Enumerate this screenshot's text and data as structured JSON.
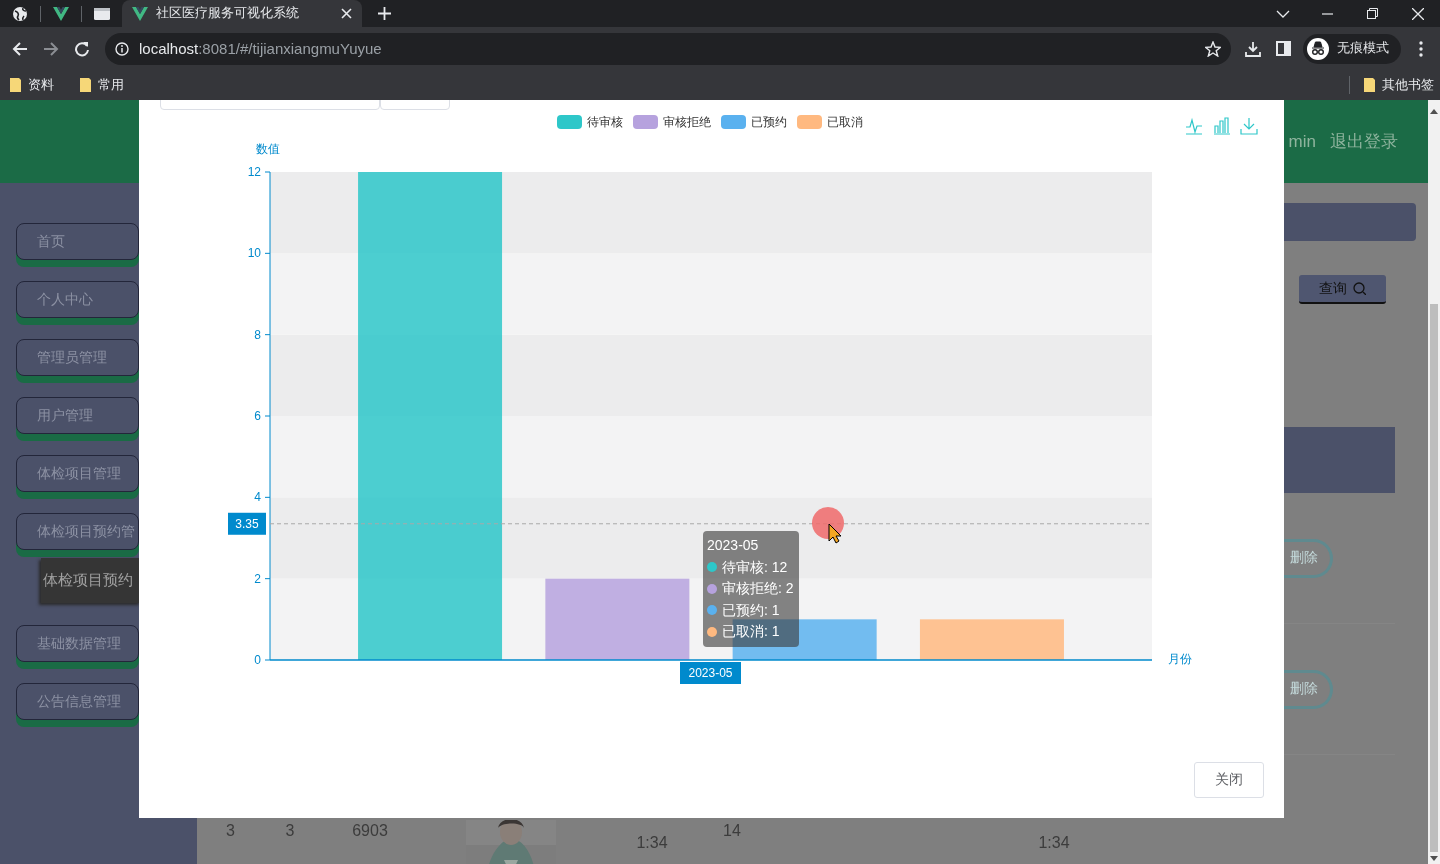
{
  "browser": {
    "tabs": [
      {
        "kind": "globe",
        "selected": false
      },
      {
        "kind": "vue",
        "selected": false
      },
      {
        "kind": "window",
        "selected": false
      },
      {
        "kind": "vue",
        "title": "社区医疗服务可视化系统",
        "selected": true
      }
    ],
    "url": {
      "host": "localhost",
      "path": ":8081/#/tijianxiangmuYuyue"
    },
    "profile": "无痕模式",
    "bookmarks": [
      "资料",
      "常用"
    ],
    "other_bookmarks": "其他书签"
  },
  "header": {
    "user": "min",
    "logout": "退出登录"
  },
  "sidebar": {
    "items": [
      {
        "label": "首页"
      },
      {
        "label": "个人中心"
      },
      {
        "label": "管理员管理"
      },
      {
        "label": "用户管理"
      },
      {
        "label": "体检项目管理"
      },
      {
        "label": "体检项目预约管",
        "children": [
          {
            "label": "体检项目预约"
          }
        ]
      },
      {
        "label": "基础数据管理"
      },
      {
        "label": "公告信息管理"
      }
    ]
  },
  "content": {
    "search_button": "查询",
    "table": {
      "rows": [
        {
          "delete_button": "删除"
        },
        {
          "delete_button": "删除"
        },
        {
          "cells": [
            {
              "kind": "text",
              "text": "3"
            },
            {
              "kind": "text",
              "text": "3"
            },
            {
              "kind": "text",
              "text": "6903"
            },
            {
              "kind": "picture"
            },
            {
              "kind": "wrapped",
              "text": "1:34"
            },
            {
              "kind": "text",
              "text": "14"
            },
            {
              "kind": "wrapped",
              "text": "1:34"
            }
          ]
        }
      ]
    }
  },
  "modal": {
    "chart_data": {
      "type": "bar",
      "xlabel": "月份",
      "ylabel": "数值",
      "series": [
        {
          "name": "待审核",
          "color": "#2ec7c9",
          "values": [
            12
          ]
        },
        {
          "name": "审核拒绝",
          "color": "#b6a2de",
          "values": [
            2
          ]
        },
        {
          "name": "已预约",
          "color": "#5ab1ef",
          "values": [
            1
          ]
        },
        {
          "name": "已取消",
          "color": "#ffb980",
          "values": [
            1
          ]
        }
      ],
      "ylim": [
        0,
        12
      ],
      "yticks": [
        0,
        2,
        4,
        6,
        8,
        10,
        12
      ],
      "legend": "top"
    },
    "pointer_value": "3.35",
    "pointer_category": "2023-05",
    "tooltip": {
      "title": "2023-05",
      "items": [
        {
          "label": "待审核: 12",
          "color": "#2ec7c9"
        },
        {
          "label": "审核拒绝: 2",
          "color": "#b6a2de"
        },
        {
          "label": "已预约: 1",
          "color": "#5ab1ef"
        },
        {
          "label": "已取消: 1",
          "color": "#ffb980"
        }
      ]
    },
    "close_button": "关闭"
  }
}
